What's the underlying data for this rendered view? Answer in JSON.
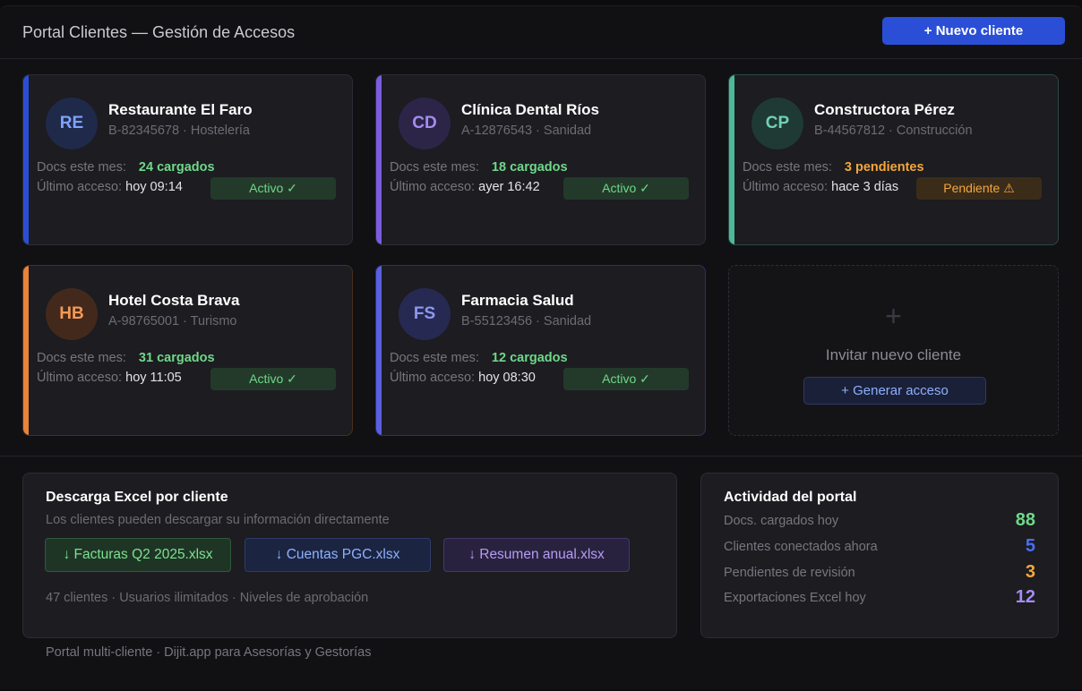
{
  "header": {
    "title": "Portal Clientes — Gestión de Accesos",
    "new_client_label": "+ Nuevo cliente"
  },
  "labels": {
    "docs": "Docs este mes:",
    "access": "Último acceso:"
  },
  "clients": [
    {
      "initials": "RE",
      "name": "Restaurante El Faro",
      "meta": "B-82345678 · Hostelería",
      "docs": "24 cargados",
      "last_access": "hoy 09:14",
      "status": "Activo ✓"
    },
    {
      "initials": "CD",
      "name": "Clínica Dental Ríos",
      "meta": "A-12876543 · Sanidad",
      "docs": "18 cargados",
      "last_access": "ayer 16:42",
      "status": "Activo ✓"
    },
    {
      "initials": "CP",
      "name": "Constructora Pérez",
      "meta": "B-44567812 · Construcción",
      "docs": "3 pendientes",
      "last_access": "hace 3 días",
      "status": "Pendiente ⚠"
    },
    {
      "initials": "HB",
      "name": "Hotel Costa Brava",
      "meta": "A-98765001 · Turismo",
      "docs": "31 cargados",
      "last_access": "hoy 11:05",
      "status": "Activo ✓"
    },
    {
      "initials": "FS",
      "name": "Farmacia Salud",
      "meta": "B-55123456 · Sanidad",
      "docs": "12 cargados",
      "last_access": "hoy 08:30",
      "status": "Activo ✓"
    }
  ],
  "invite": {
    "label": "Invitar nuevo cliente",
    "button": "+ Generar acceso"
  },
  "excel": {
    "title": "Descarga Excel por cliente",
    "subtitle": "Los clientes pueden descargar su información directamente",
    "buttons": [
      "↓ Facturas Q2 2025.xlsx",
      "↓ Cuentas PGC.xlsx",
      "↓ Resumen anual.xlsx"
    ],
    "footer": "47 clientes · Usuarios ilimitados · Niveles de aprobación"
  },
  "activity": {
    "title": "Actividad del portal",
    "stats": [
      {
        "label": "Docs. cargados hoy",
        "value": "88"
      },
      {
        "label": "Clientes conectados ahora",
        "value": "5"
      },
      {
        "label": "Pendientes de revisión",
        "value": "3"
      },
      {
        "label": "Exportaciones Excel hoy",
        "value": "12"
      }
    ]
  },
  "footer": "Portal multi-cliente · Dijit.app para Asesorías y Gestorías",
  "colors": {
    "blue": "#2a4fd6",
    "purple": "#7b5ce0",
    "teal": "#4fb79a",
    "orange": "#e8833a",
    "indigo": "#5a5fe0",
    "green": "#6fd889",
    "amber": "#f5a63a"
  }
}
